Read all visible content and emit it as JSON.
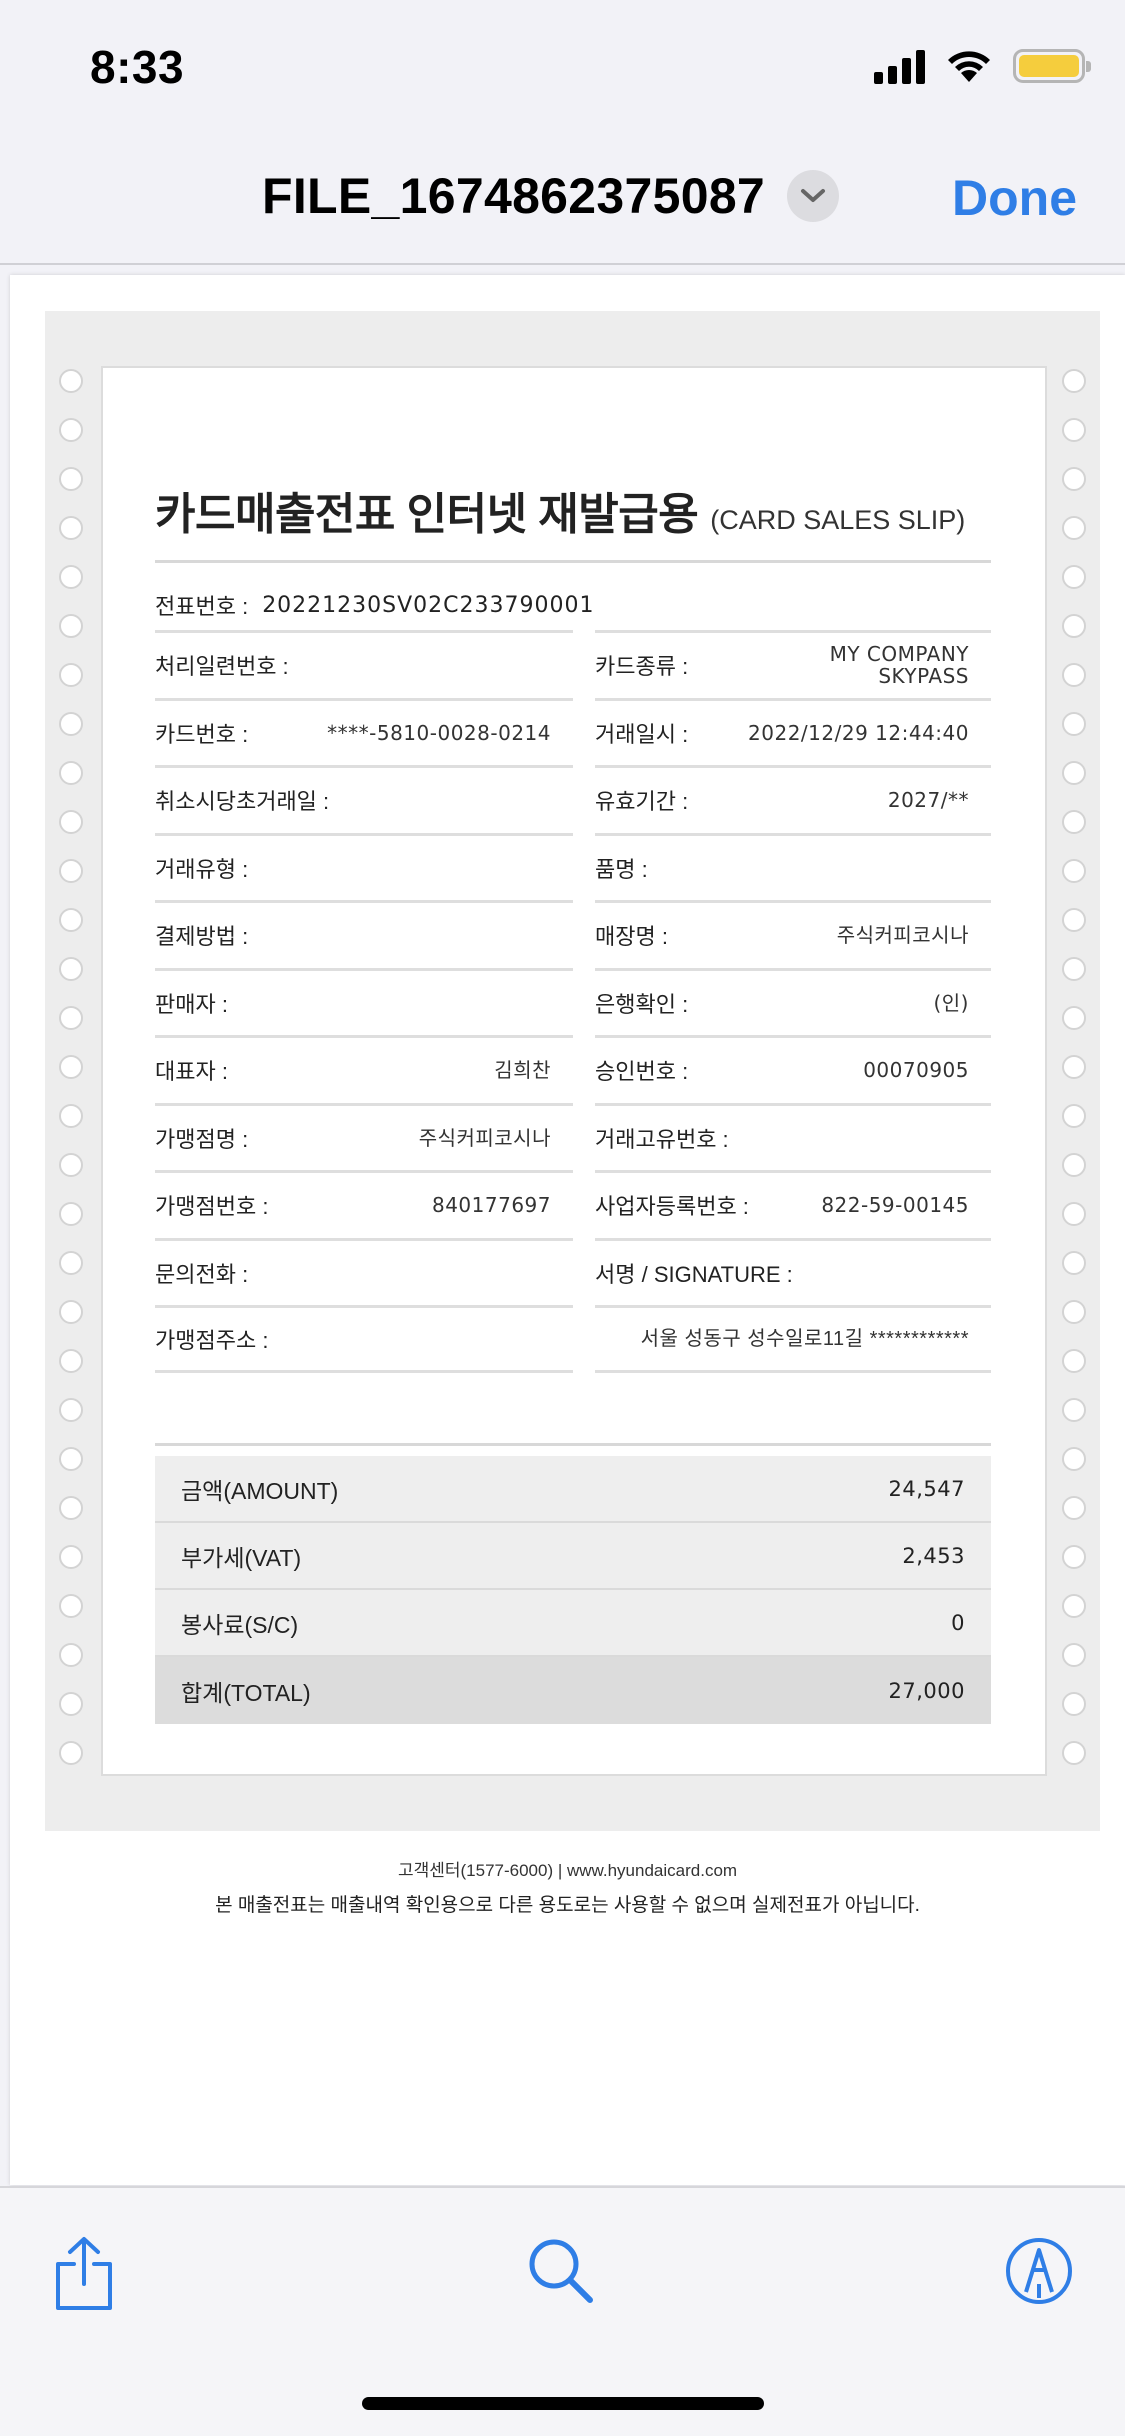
{
  "status_bar": {
    "time": "8:33"
  },
  "nav": {
    "title": "FILE_1674862375087",
    "done_label": "Done"
  },
  "slip": {
    "title_ko": "카드매출전표 인터넷 재발급용",
    "title_en": "(CARD SALES SLIP)",
    "slip_number_label": "전표번호 :",
    "slip_number": "20221230SV02C233790001",
    "left_fields": [
      {
        "label": "처리일련번호 :",
        "value": ""
      },
      {
        "label": "카드번호 :",
        "value": "****-5810-0028-0214"
      },
      {
        "label": "취소시당초거래일 :",
        "value": ""
      },
      {
        "label": "거래유형 :",
        "value": ""
      },
      {
        "label": "결제방법 :",
        "value": ""
      },
      {
        "label": "판매자 :",
        "value": ""
      },
      {
        "label": "대표자 :",
        "value": "김희찬"
      },
      {
        "label": "가맹점명 :",
        "value": "주식커피코시나"
      },
      {
        "label": "가맹점번호 :",
        "value": "840177697"
      },
      {
        "label": "문의전화 :",
        "value": ""
      },
      {
        "label": "가맹점주소 :",
        "value": ""
      }
    ],
    "right_fields": [
      {
        "label": "카드종류 :",
        "value_line1": "MY COMPANY",
        "value_line2": "SKYPASS"
      },
      {
        "label": "거래일시 :",
        "value_line1": "2022/12/29 12:44:40",
        "value_line2": ""
      },
      {
        "label": "유효기간 :",
        "value_line1": "2027/**",
        "value_line2": ""
      },
      {
        "label": "품명 :",
        "value_line1": "",
        "value_line2": ""
      },
      {
        "label": "매장명 :",
        "value_line1": "주식커피코시나",
        "value_line2": ""
      },
      {
        "label": "은행확인 :",
        "value_line1": "(인)",
        "value_line2": ""
      },
      {
        "label": "승인번호 :",
        "value_line1": "00070905",
        "value_line2": ""
      },
      {
        "label": "거래고유번호 :",
        "value_line1": "",
        "value_line2": ""
      },
      {
        "label": "사업자등록번호 :",
        "value_line1": "822-59-00145",
        "value_line2": ""
      },
      {
        "label": "서명 / SIGNATURE :",
        "value_line1": "",
        "value_line2": ""
      },
      {
        "label": "",
        "value_line1": "서울 성동구 성수일로11길 ************",
        "value_line2": ""
      }
    ],
    "totals": [
      {
        "label": "금액(AMOUNT)",
        "value": "24,547"
      },
      {
        "label": "부가세(VAT)",
        "value": "2,453"
      },
      {
        "label": "봉사료(S/C)",
        "value": "0"
      },
      {
        "label": "합계(TOTAL)",
        "value": "27,000"
      }
    ]
  },
  "footer": {
    "line1": "고객센터(1577-6000)  |  www.hyundaicard.com",
    "line2": "본 매출전표는 매출내역 확인용으로 다른 용도로는 사용할 수 없으며 실제전표가 아닙니다."
  },
  "toolbar": {
    "icons": [
      "share-icon",
      "search-icon",
      "markup-icon"
    ],
    "accent_color": "#2f7ee6"
  }
}
